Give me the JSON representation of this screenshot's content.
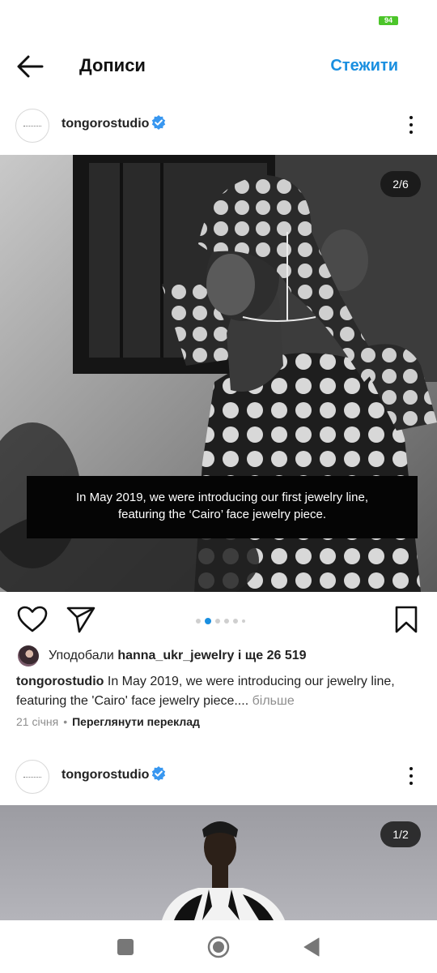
{
  "status_bar": {
    "battery": "94"
  },
  "header": {
    "title": "Дописи",
    "follow_label": "Стежити"
  },
  "posts": [
    {
      "username": "tongorostudio",
      "counter": "2/6",
      "image_caption_line1": "In May 2019, we were introducing our first jewelry line,",
      "image_caption_line2": "featuring the ‘Cairo’ face jewelry piece.",
      "likes_prefix": "Уподобали ",
      "likes_user": "hanna_ukr_jewelry",
      "likes_suffix": " і ще 26 519",
      "caption_user": "tongorostudio",
      "caption_text": " In May 2019, we were introducing our jewelry line, featuring the 'Cairo' face jewelry piece.... ",
      "caption_more": "більше",
      "date": "21 січня",
      "separator": "•",
      "translate_label": "Переглянути переклад",
      "pager": {
        "count": 6,
        "active": 1
      }
    },
    {
      "username": "tongorostudio",
      "counter": "1/2"
    }
  ],
  "colors": {
    "accent": "#1a8fe0",
    "verified": "#3897f0",
    "battery": "#4cc52a"
  },
  "icons": [
    "back-arrow-icon",
    "verified-badge-icon",
    "more-vertical-icon",
    "heart-icon",
    "send-icon",
    "bookmark-icon",
    "square-nav-icon",
    "circle-home-icon",
    "triangle-back-icon"
  ]
}
